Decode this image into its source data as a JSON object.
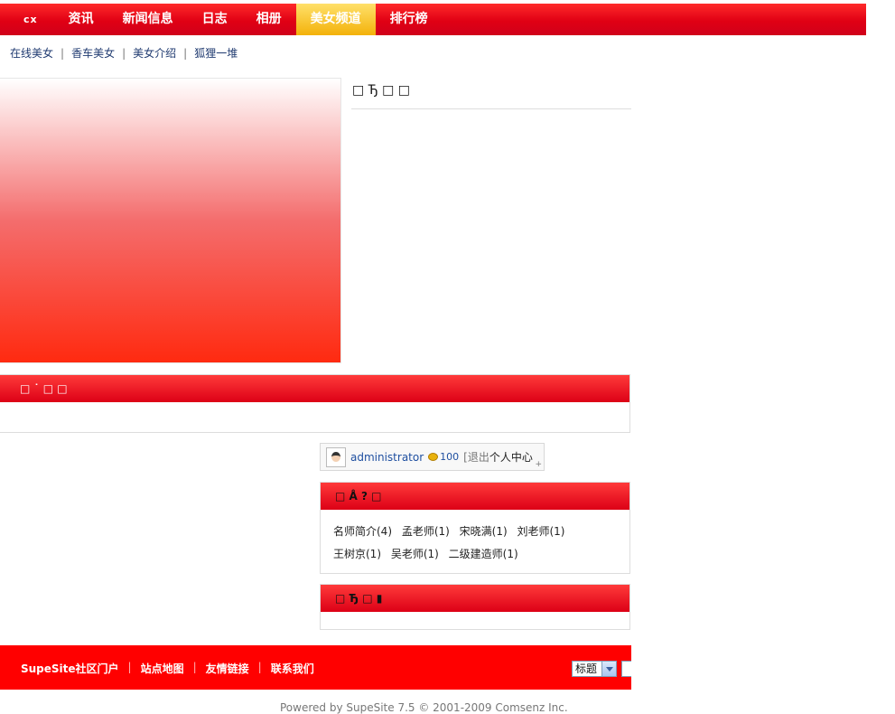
{
  "nav": {
    "logo": "cx",
    "items": [
      "资讯",
      "新闻信息",
      "日志",
      "相册",
      "美女频道",
      "排行榜"
    ],
    "active_index": 4
  },
  "subnav": [
    "在线美女",
    "香车美女",
    "美女介绍",
    "狐狸一堆"
  ],
  "hero": {
    "title": "□ Ђ □ □"
  },
  "red_box": {
    "title": "□ ˙ □ □"
  },
  "user": {
    "name": "administrator",
    "credits": "100",
    "logout": "[退出",
    "center": "个人中心"
  },
  "tag_box": {
    "title": "□ Å ? □",
    "tags": [
      "名师简介(4)",
      "孟老师(1)",
      "宋晓满(1)",
      "刘老师(1)",
      "王树京(1)",
      "吴老师(1)",
      "二级建造师(1)"
    ]
  },
  "small_box": {
    "title": "□ Ђ □ ▮"
  },
  "footer": {
    "links": [
      "SupeSite社区门户",
      "站点地图",
      "友情链接",
      "联系我们"
    ],
    "search_option": "标题",
    "powered": "Powered by SupeSite 7.5 © 2001-2009 Comsenz Inc."
  },
  "colors": {
    "brand_red": "#e00014",
    "active_tab": "#f3b20a",
    "link_blue": "#1f4fa0"
  }
}
